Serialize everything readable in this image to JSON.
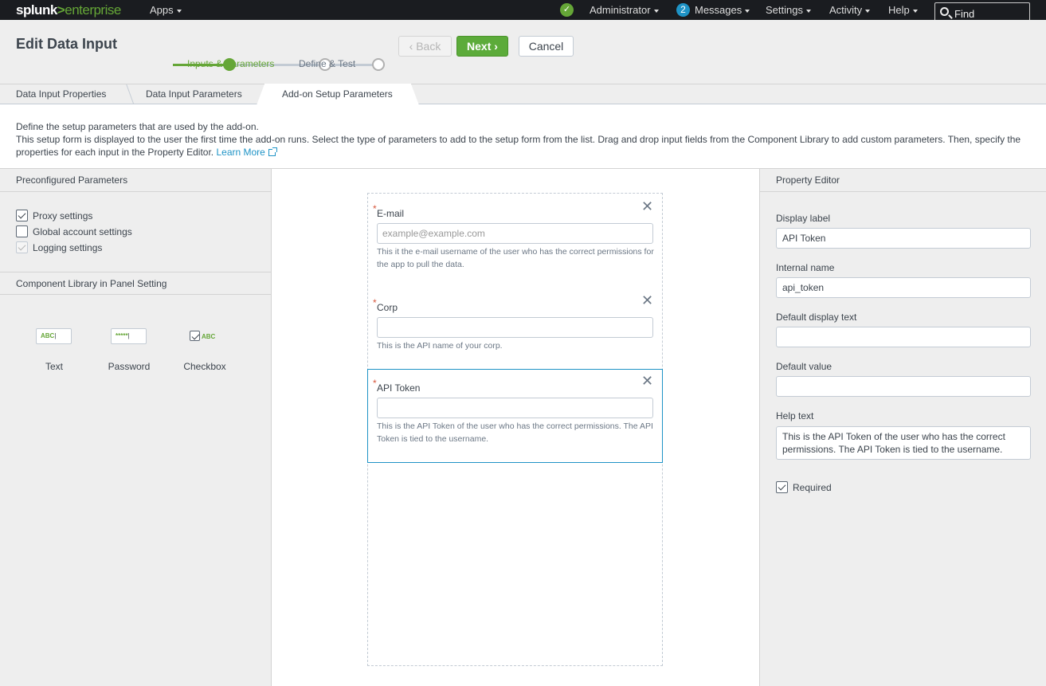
{
  "topbar": {
    "logo_main": "splunk",
    "logo_gt": ">",
    "logo_sub": "enterprise",
    "apps": "Apps",
    "user": "Administrator",
    "messages_count": "2",
    "messages": "Messages",
    "settings": "Settings",
    "activity": "Activity",
    "help": "Help",
    "find": "Find"
  },
  "header": {
    "title": "Edit Data Input",
    "steps": [
      "Inputs & Parameters",
      "Define & Test"
    ],
    "progress_step": 1,
    "back": "Back",
    "next": "Next",
    "cancel": "Cancel"
  },
  "tabs": [
    "Data Input Properties",
    "Data Input Parameters",
    "Add-on Setup Parameters"
  ],
  "description": {
    "line1": "Define the setup parameters that are used by the add-on.",
    "line2": "This setup form is displayed to the user the first time the add-on runs. Select the type of parameters to add to the setup form from the list. Drag and drop input fields from the Component Library to add custom parameters. Then, specify the properties for each input in the Property Editor.",
    "learn_more": "Learn More"
  },
  "left": {
    "preconfigured_title": "Preconfigured Parameters",
    "options": [
      {
        "label": "Proxy settings",
        "checked": true
      },
      {
        "label": "Global account settings",
        "checked": false
      },
      {
        "label": "Logging settings",
        "checked": true,
        "disabled": true
      }
    ],
    "library_title": "Component Library in Panel Setting",
    "components": [
      {
        "label": "Text",
        "icon_text": "ABC"
      },
      {
        "label": "Password",
        "icon_text": "*****"
      },
      {
        "label": "Checkbox",
        "icon_text": "ABC"
      }
    ]
  },
  "form": {
    "fields": [
      {
        "label": "E-mail",
        "placeholder": "example@example.com",
        "help": "This it the e-mail username of the user who has the correct permissions for the app to pull the data."
      },
      {
        "label": "Corp",
        "placeholder": "",
        "help": "This is the API name of your corp."
      },
      {
        "label": "API Token",
        "placeholder": "",
        "help": "This is the API Token of the user who has the correct permissions. The API Token is tied to the username."
      }
    ],
    "required_mark": "*",
    "close_glyph": "✕"
  },
  "property_editor": {
    "title": "Property Editor",
    "display_label": "Display label",
    "display_label_value": "API Token",
    "internal_name": "Internal name",
    "internal_name_value": "api_token",
    "default_display_text": "Default display text",
    "default_display_text_value": "",
    "default_value": "Default value",
    "default_value_value": "",
    "help_text": "Help text",
    "help_text_value": "This is the API Token of the user who has the correct permissions. The API Token is tied to the username.",
    "required": "Required",
    "required_checked": true
  },
  "colors": {
    "accent": "#65a637",
    "link": "#1e93c6",
    "topbar": "#1a1c20",
    "required": "#d6563c"
  }
}
